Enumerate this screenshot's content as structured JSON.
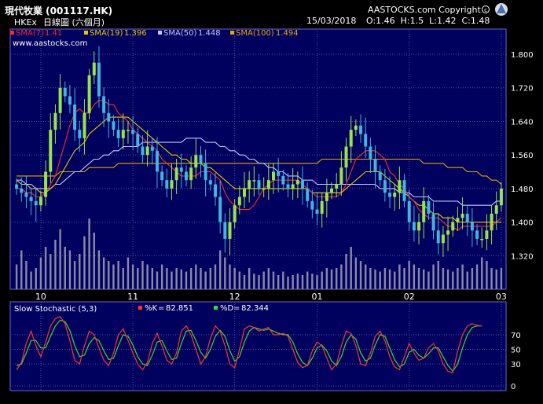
{
  "header": {
    "title": "現代牧業 (001117.HK)",
    "exchange": "HKEx",
    "period": "日線圖 (六個月)",
    "copyright": "AASTOCKS.com Copyright",
    "website": "www.aastocks.com",
    "date": "15/03/2018",
    "ohlc": "O:1.46  H:1.5  L:1.42  C:1.48"
  },
  "colors": {
    "background": "#000000",
    "plot_bg": "#00005e",
    "grid": "#4a4aa8",
    "candle_up": "#9ae34c",
    "candle_down": "#43b3e0",
    "sma7": "#ff2a2a",
    "sma19": "#e8c800",
    "sma50": "#c7c7ff",
    "sma100": "#e6a600",
    "volume": "#8a8aa8",
    "stoch_k": "#ff3333",
    "stoch_d": "#33dd33"
  },
  "chart_data": [
    {
      "type": "candlestick",
      "title": "現代牧業 (001117.HK)",
      "ylim": [
        1.24,
        1.86
      ],
      "yticks": [
        1.32,
        1.4,
        1.48,
        1.56,
        1.64,
        1.72,
        1.8
      ],
      "ytick_labels": [
        "1.320",
        "1.400",
        "1.480",
        "1.560",
        "1.640",
        "1.720",
        "1.800"
      ],
      "x_labels": [
        {
          "label": "10",
          "index": 5
        },
        {
          "label": "11",
          "index": 24
        },
        {
          "label": "12",
          "index": 45
        },
        {
          "label": "01",
          "index": 62
        },
        {
          "label": "02",
          "index": 81
        },
        {
          "label": "03",
          "index": 100
        }
      ],
      "legend": [
        {
          "label": "SMA(7)",
          "value": "1.41"
        },
        {
          "label": "SMA(19)",
          "value": "1.396"
        },
        {
          "label": "SMA(50)",
          "value": "1.448"
        },
        {
          "label": "SMA(100)",
          "value": "1.494"
        }
      ],
      "close": [
        1.48,
        1.47,
        1.46,
        1.45,
        1.44,
        1.46,
        1.52,
        1.62,
        1.66,
        1.72,
        1.7,
        1.68,
        1.62,
        1.6,
        1.66,
        1.75,
        1.78,
        1.7,
        1.66,
        1.64,
        1.62,
        1.6,
        1.62,
        1.62,
        1.61,
        1.58,
        1.56,
        1.58,
        1.57,
        1.52,
        1.5,
        1.48,
        1.5,
        1.53,
        1.52,
        1.5,
        1.53,
        1.56,
        1.54,
        1.5,
        1.49,
        1.46,
        1.4,
        1.36,
        1.4,
        1.44,
        1.46,
        1.48,
        1.5,
        1.5,
        1.48,
        1.48,
        1.5,
        1.52,
        1.51,
        1.49,
        1.48,
        1.49,
        1.5,
        1.48,
        1.45,
        1.43,
        1.42,
        1.45,
        1.47,
        1.48,
        1.49,
        1.53,
        1.58,
        1.62,
        1.63,
        1.61,
        1.58,
        1.55,
        1.52,
        1.5,
        1.47,
        1.46,
        1.47,
        1.5,
        1.45,
        1.4,
        1.38,
        1.4,
        1.45,
        1.42,
        1.38,
        1.35,
        1.37,
        1.38,
        1.4,
        1.41,
        1.42,
        1.4,
        1.38,
        1.36,
        1.36,
        1.38,
        1.42,
        1.44,
        1.48
      ],
      "sma7": [
        1.48,
        1.48,
        1.47,
        1.47,
        1.46,
        1.46,
        1.47,
        1.49,
        1.51,
        1.55,
        1.59,
        1.63,
        1.66,
        1.67,
        1.66,
        1.66,
        1.68,
        1.69,
        1.69,
        1.68,
        1.68,
        1.66,
        1.65,
        1.64,
        1.62,
        1.61,
        1.6,
        1.59,
        1.58,
        1.57,
        1.55,
        1.54,
        1.53,
        1.52,
        1.51,
        1.51,
        1.51,
        1.51,
        1.52,
        1.52,
        1.52,
        1.51,
        1.5,
        1.47,
        1.45,
        1.44,
        1.43,
        1.43,
        1.43,
        1.44,
        1.46,
        1.48,
        1.49,
        1.5,
        1.5,
        1.5,
        1.5,
        1.5,
        1.5,
        1.49,
        1.48,
        1.47,
        1.46,
        1.46,
        1.46,
        1.46,
        1.46,
        1.47,
        1.49,
        1.52,
        1.55,
        1.56,
        1.57,
        1.57,
        1.57,
        1.56,
        1.55,
        1.52,
        1.51,
        1.49,
        1.48,
        1.46,
        1.45,
        1.43,
        1.42,
        1.41,
        1.41,
        1.41,
        1.4,
        1.39,
        1.39,
        1.38,
        1.39,
        1.39,
        1.39,
        1.39,
        1.39,
        1.39,
        1.39,
        1.4,
        1.41
      ],
      "sma19": [
        1.5,
        1.49,
        1.49,
        1.48,
        1.48,
        1.47,
        1.47,
        1.48,
        1.49,
        1.51,
        1.53,
        1.55,
        1.57,
        1.58,
        1.59,
        1.61,
        1.62,
        1.63,
        1.64,
        1.65,
        1.65,
        1.65,
        1.65,
        1.65,
        1.64,
        1.63,
        1.62,
        1.61,
        1.6,
        1.59,
        1.58,
        1.57,
        1.56,
        1.56,
        1.55,
        1.55,
        1.54,
        1.54,
        1.54,
        1.53,
        1.53,
        1.52,
        1.51,
        1.5,
        1.49,
        1.48,
        1.48,
        1.48,
        1.48,
        1.48,
        1.48,
        1.48,
        1.48,
        1.48,
        1.48,
        1.48,
        1.48,
        1.48,
        1.48,
        1.48,
        1.48,
        1.47,
        1.47,
        1.47,
        1.47,
        1.47,
        1.47,
        1.47,
        1.48,
        1.49,
        1.5,
        1.51,
        1.52,
        1.52,
        1.52,
        1.52,
        1.51,
        1.5,
        1.49,
        1.48,
        1.47,
        1.46,
        1.45,
        1.44,
        1.44,
        1.43,
        1.42,
        1.42,
        1.41,
        1.41,
        1.41,
        1.4,
        1.4,
        1.4,
        1.4,
        1.4,
        1.4,
        1.4,
        1.4,
        1.4,
        1.4
      ],
      "sma50": [
        1.5,
        1.5,
        1.49,
        1.49,
        1.48,
        1.48,
        1.48,
        1.48,
        1.49,
        1.49,
        1.5,
        1.51,
        1.52,
        1.52,
        1.53,
        1.54,
        1.55,
        1.55,
        1.56,
        1.56,
        1.57,
        1.57,
        1.58,
        1.58,
        1.58,
        1.58,
        1.59,
        1.59,
        1.59,
        1.59,
        1.59,
        1.59,
        1.59,
        1.59,
        1.59,
        1.6,
        1.6,
        1.6,
        1.6,
        1.59,
        1.59,
        1.59,
        1.58,
        1.58,
        1.57,
        1.57,
        1.56,
        1.56,
        1.55,
        1.55,
        1.54,
        1.54,
        1.53,
        1.53,
        1.52,
        1.52,
        1.51,
        1.51,
        1.51,
        1.5,
        1.5,
        1.5,
        1.49,
        1.49,
        1.49,
        1.49,
        1.49,
        1.49,
        1.49,
        1.49,
        1.49,
        1.49,
        1.49,
        1.49,
        1.49,
        1.48,
        1.48,
        1.48,
        1.48,
        1.47,
        1.47,
        1.47,
        1.46,
        1.46,
        1.46,
        1.46,
        1.45,
        1.45,
        1.45,
        1.45,
        1.45,
        1.45,
        1.44,
        1.44,
        1.44,
        1.44,
        1.44,
        1.44,
        1.44,
        1.45,
        1.45
      ],
      "sma100": [
        1.51,
        1.51,
        1.51,
        1.51,
        1.51,
        1.51,
        1.51,
        1.51,
        1.51,
        1.52,
        1.52,
        1.52,
        1.52,
        1.52,
        1.52,
        1.53,
        1.53,
        1.53,
        1.53,
        1.53,
        1.53,
        1.54,
        1.54,
        1.54,
        1.54,
        1.54,
        1.54,
        1.54,
        1.54,
        1.54,
        1.54,
        1.54,
        1.54,
        1.54,
        1.54,
        1.54,
        1.54,
        1.54,
        1.54,
        1.54,
        1.54,
        1.54,
        1.54,
        1.54,
        1.54,
        1.54,
        1.54,
        1.54,
        1.54,
        1.54,
        1.54,
        1.54,
        1.54,
        1.54,
        1.54,
        1.54,
        1.54,
        1.54,
        1.54,
        1.54,
        1.54,
        1.54,
        1.54,
        1.55,
        1.55,
        1.55,
        1.55,
        1.55,
        1.55,
        1.55,
        1.55,
        1.55,
        1.55,
        1.55,
        1.55,
        1.55,
        1.55,
        1.55,
        1.55,
        1.55,
        1.55,
        1.55,
        1.55,
        1.55,
        1.54,
        1.54,
        1.54,
        1.54,
        1.54,
        1.53,
        1.53,
        1.53,
        1.53,
        1.52,
        1.52,
        1.52,
        1.51,
        1.51,
        1.5,
        1.5,
        1.49
      ],
      "volume": [
        0.35,
        0.55,
        0.4,
        0.25,
        0.3,
        0.45,
        0.6,
        0.5,
        0.7,
        0.85,
        0.6,
        0.55,
        0.4,
        0.5,
        0.75,
        1.0,
        0.8,
        0.55,
        0.45,
        0.4,
        0.35,
        0.4,
        0.3,
        0.45,
        0.35,
        0.3,
        0.4,
        0.35,
        0.3,
        0.25,
        0.35,
        0.3,
        0.25,
        0.3,
        0.28,
        0.25,
        0.3,
        0.35,
        0.3,
        0.25,
        0.3,
        0.35,
        0.55,
        0.45,
        0.35,
        0.3,
        0.25,
        0.2,
        0.3,
        0.22,
        0.2,
        0.25,
        0.3,
        0.25,
        0.2,
        0.25,
        0.18,
        0.2,
        0.22,
        0.2,
        0.25,
        0.22,
        0.2,
        0.25,
        0.3,
        0.28,
        0.3,
        0.35,
        0.5,
        0.6,
        0.45,
        0.4,
        0.35,
        0.3,
        0.28,
        0.25,
        0.3,
        0.28,
        0.25,
        0.35,
        0.3,
        0.4,
        0.35,
        0.3,
        0.28,
        0.25,
        0.35,
        0.4,
        0.3,
        0.28,
        0.25,
        0.3,
        0.35,
        0.25,
        0.3,
        0.35,
        0.45,
        0.4,
        0.3,
        0.28,
        0.3
      ]
    },
    {
      "type": "line",
      "title": "Slow Stochastic (5,3)",
      "ylim": [
        0,
        100
      ],
      "yticks": [
        0,
        30,
        50,
        70
      ],
      "series": [
        {
          "name": "%K",
          "value": "82.851",
          "values": [
            22,
            32,
            58,
            75,
            55,
            40,
            60,
            82,
            92,
            95,
            85,
            62,
            35,
            30,
            55,
            75,
            70,
            52,
            35,
            28,
            45,
            70,
            78,
            62,
            45,
            30,
            22,
            32,
            58,
            72,
            55,
            35,
            30,
            45,
            75,
            82,
            70,
            50,
            30,
            40,
            65,
            82,
            75,
            55,
            30,
            25,
            50,
            78,
            82,
            80,
            75,
            78,
            80,
            70,
            70,
            72,
            68,
            50,
            32,
            25,
            28,
            48,
            60,
            55,
            38,
            22,
            30,
            55,
            75,
            72,
            55,
            30,
            28,
            45,
            68,
            75,
            62,
            40,
            26,
            22,
            40,
            58,
            45,
            35,
            38,
            52,
            58,
            48,
            30,
            20,
            18,
            48,
            70,
            82,
            85,
            83,
            82
          ]
        },
        {
          "name": "%D",
          "value": "82.344",
          "values": [
            28,
            30,
            45,
            62,
            62,
            52,
            52,
            68,
            82,
            90,
            88,
            76,
            55,
            40,
            42,
            58,
            66,
            62,
            48,
            36,
            38,
            55,
            70,
            68,
            56,
            40,
            30,
            28,
            42,
            60,
            62,
            48,
            36,
            38,
            58,
            75,
            76,
            62,
            46,
            38,
            50,
            68,
            76,
            68,
            48,
            34,
            40,
            60,
            75,
            80,
            78,
            76,
            78,
            75,
            72,
            70,
            70,
            60,
            44,
            32,
            28,
            38,
            52,
            56,
            48,
            34,
            28,
            40,
            60,
            70,
            64,
            45,
            34,
            38,
            56,
            70,
            68,
            52,
            36,
            26,
            30,
            46,
            50,
            42,
            38,
            44,
            52,
            52,
            40,
            28,
            20,
            30,
            52,
            70,
            80,
            82,
            82
          ]
        }
      ],
      "reference_lines": [
        30,
        70
      ]
    }
  ]
}
